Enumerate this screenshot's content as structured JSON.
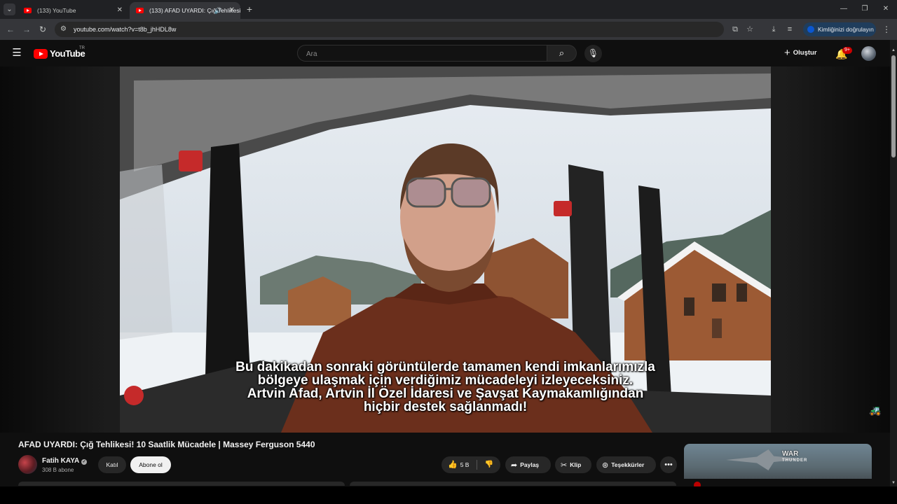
{
  "browser": {
    "tabs": [
      {
        "title": "(133) YouTube",
        "active": false
      },
      {
        "title": "(133) AFAD UYARDI: Çığ Tehlikesi! 10 Saatlik Mücadele | Massey Ferguson 5440",
        "active": true
      }
    ],
    "url": "youtube.com/watch?v=t8b_jhHDL8w",
    "verify_label": "Kimliğinizi doğrulayın"
  },
  "youtube": {
    "logo_text": "YouTube",
    "country_code": "TR",
    "search_placeholder": "Ara",
    "create_label": "Oluştur",
    "notification_count": "9+"
  },
  "video": {
    "subtitle_lines": [
      "Bu dakikadan sonraki görüntülerde tamamen kendi imkanlarımızla",
      "bölgeye ulaşmak için verdiğimiz mücadeleyi izleyeceksiniz.",
      "Artvin Afad, Artvin İl Özel İdaresi ve Şavşat Kaymakamlığından",
      "hiçbir destek sağlanmadı!"
    ],
    "title": "AFAD UYARDI: Çığ Tehlikesi! 10 Saatlik Mücadele | Massey Ferguson 5440"
  },
  "channel": {
    "name": "Fatih KAYA",
    "subscribers": "308 B abone",
    "join_label": "Katıl",
    "subscribe_label": "Abone ol"
  },
  "actions": {
    "like_count": "5 B",
    "share_label": "Paylaş",
    "clip_label": "Klip",
    "thanks_label": "Teşekkürler"
  },
  "recommendation": {
    "brand_line1": "WAR",
    "brand_line2": "THUNDER"
  },
  "colors": {
    "background": "#0f0f0f",
    "youtube_red": "#ff0000",
    "verify_blue": "#0b57d0"
  },
  "icons": [
    "search-icon",
    "microphone-icon",
    "bell-icon",
    "menu-icon",
    "like-icon",
    "dislike-icon",
    "share-icon",
    "scissors-icon",
    "thanks-icon",
    "more-icon"
  ]
}
